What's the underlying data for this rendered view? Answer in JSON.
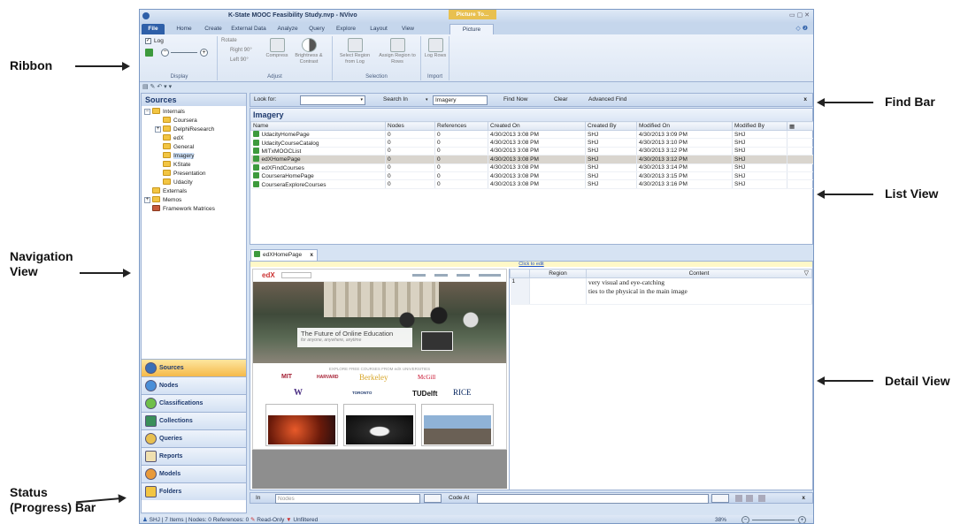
{
  "callouts": {
    "ribbon": "Ribbon",
    "navigation": [
      "Navigation",
      "View"
    ],
    "status": [
      "Status",
      "(Progress) Bar"
    ],
    "find_bar": "Find Bar",
    "list_view": "List View",
    "detail_view": "Detail View"
  },
  "window": {
    "title": "K-State MOOC Feasibility Study.nvp - NVivo",
    "context_tab": "Picture To...",
    "controls": "▭ ▢ ✕",
    "help": "◇ ❷"
  },
  "tabs": [
    "File",
    "Home",
    "Create",
    "External Data",
    "Analyze",
    "Query",
    "Explore",
    "Layout",
    "View",
    "Picture"
  ],
  "ribbon": {
    "display": {
      "log_label": "Log",
      "group": "Display"
    },
    "adjust": {
      "rotate": "Rotate",
      "right": "Right 90°",
      "left": "Left 90°",
      "compress": "Compress",
      "brightness": "Brightness & Contrast",
      "group": "Adjust"
    },
    "selection": {
      "select_region": "Select Region from Log",
      "assign_region": "Assign Region to Rows",
      "group": "Selection"
    },
    "import": {
      "log_rows": "Log Rows",
      "group": "Import"
    }
  },
  "qat": "▤ ✎ ↶ ▾ ▾",
  "nav": {
    "header": "Sources",
    "tree": {
      "internals": "Internals",
      "coursera": "Coursera",
      "delphi": "DelphiResearch",
      "edx": "edX",
      "general": "General",
      "imagery": "Imagery",
      "kstate": "KState",
      "presentation": "Presentation",
      "udacity": "Udacity",
      "externals": "Externals",
      "memos": "Memos",
      "framework": "Framework Matrices"
    },
    "buttons": [
      "Sources",
      "Nodes",
      "Classifications",
      "Collections",
      "Queries",
      "Reports",
      "Models",
      "Folders"
    ]
  },
  "findbar": {
    "look_for": "Look for:",
    "search_in": "Search In",
    "search_value": "Imagery",
    "find_now": "Find Now",
    "clear": "Clear",
    "advanced": "Advanced Find",
    "close": "x"
  },
  "list": {
    "title": "Imagery",
    "columns": [
      "Name",
      "Nodes",
      "References",
      "Created On",
      "Created By",
      "Modified On",
      "Modified By"
    ],
    "rows": [
      [
        "UdacityHomePage",
        "0",
        "0",
        "4/30/2013 3:08 PM",
        "SHJ",
        "4/30/2013 3:09 PM",
        "SHJ"
      ],
      [
        "UdacityCourseCatalog",
        "0",
        "0",
        "4/30/2013 3:08 PM",
        "SHJ",
        "4/30/2013 3:10 PM",
        "SHJ"
      ],
      [
        "MITxMOOCList",
        "0",
        "0",
        "4/30/2013 3:08 PM",
        "SHJ",
        "4/30/2013 3:12 PM",
        "SHJ"
      ],
      [
        "edXHomePage",
        "0",
        "0",
        "4/30/2013 3:08 PM",
        "SHJ",
        "4/30/2013 3:12 PM",
        "SHJ"
      ],
      [
        "edXFindCourses",
        "0",
        "0",
        "4/30/2013 3:08 PM",
        "SHJ",
        "4/30/2013 3:14 PM",
        "SHJ"
      ],
      [
        "CourseraHomePage",
        "0",
        "0",
        "4/30/2013 3:08 PM",
        "SHJ",
        "4/30/2013 3:15 PM",
        "SHJ"
      ],
      [
        "CourseraExploreCourses",
        "0",
        "0",
        "4/30/2013 3:08 PM",
        "SHJ",
        "4/30/2013 3:16 PM",
        "SHJ"
      ]
    ]
  },
  "detail": {
    "tab": "edXHomePage",
    "click_to_edit": "Click to edit",
    "region_col": "Region",
    "content_col": "Content",
    "row_num": "1",
    "content_lines": [
      "very visual and eye-catching",
      "ties to the physical in the main image"
    ],
    "image": {
      "logo": "edX",
      "hero_text": "The Future of Online Education",
      "hero_sub": "for anyone, anywhere, anytime",
      "partners_heading": "EXPLORE FREE COURSES FROM edX UNIVERSITIES",
      "logos": [
        "MIT",
        "HARVARD",
        "Berkeley",
        "McGill",
        "W",
        "TORONTO",
        "TUDelft",
        "RICE"
      ]
    }
  },
  "coding": {
    "in": "In",
    "nodes": "Nodes",
    "code_at": "Code At",
    "close": "x"
  },
  "status": {
    "user": "SHJ",
    "items": "7 Items",
    "nodes": "Nodes: 0",
    "refs": "References: 0",
    "readonly": "Read-Only",
    "unfiltered": "Unfiltered",
    "zoom": "38%"
  },
  "colors": {
    "accent": "#2e5fa8",
    "active_nav": "#f5b949",
    "selected_row": "#d9d5ce"
  }
}
